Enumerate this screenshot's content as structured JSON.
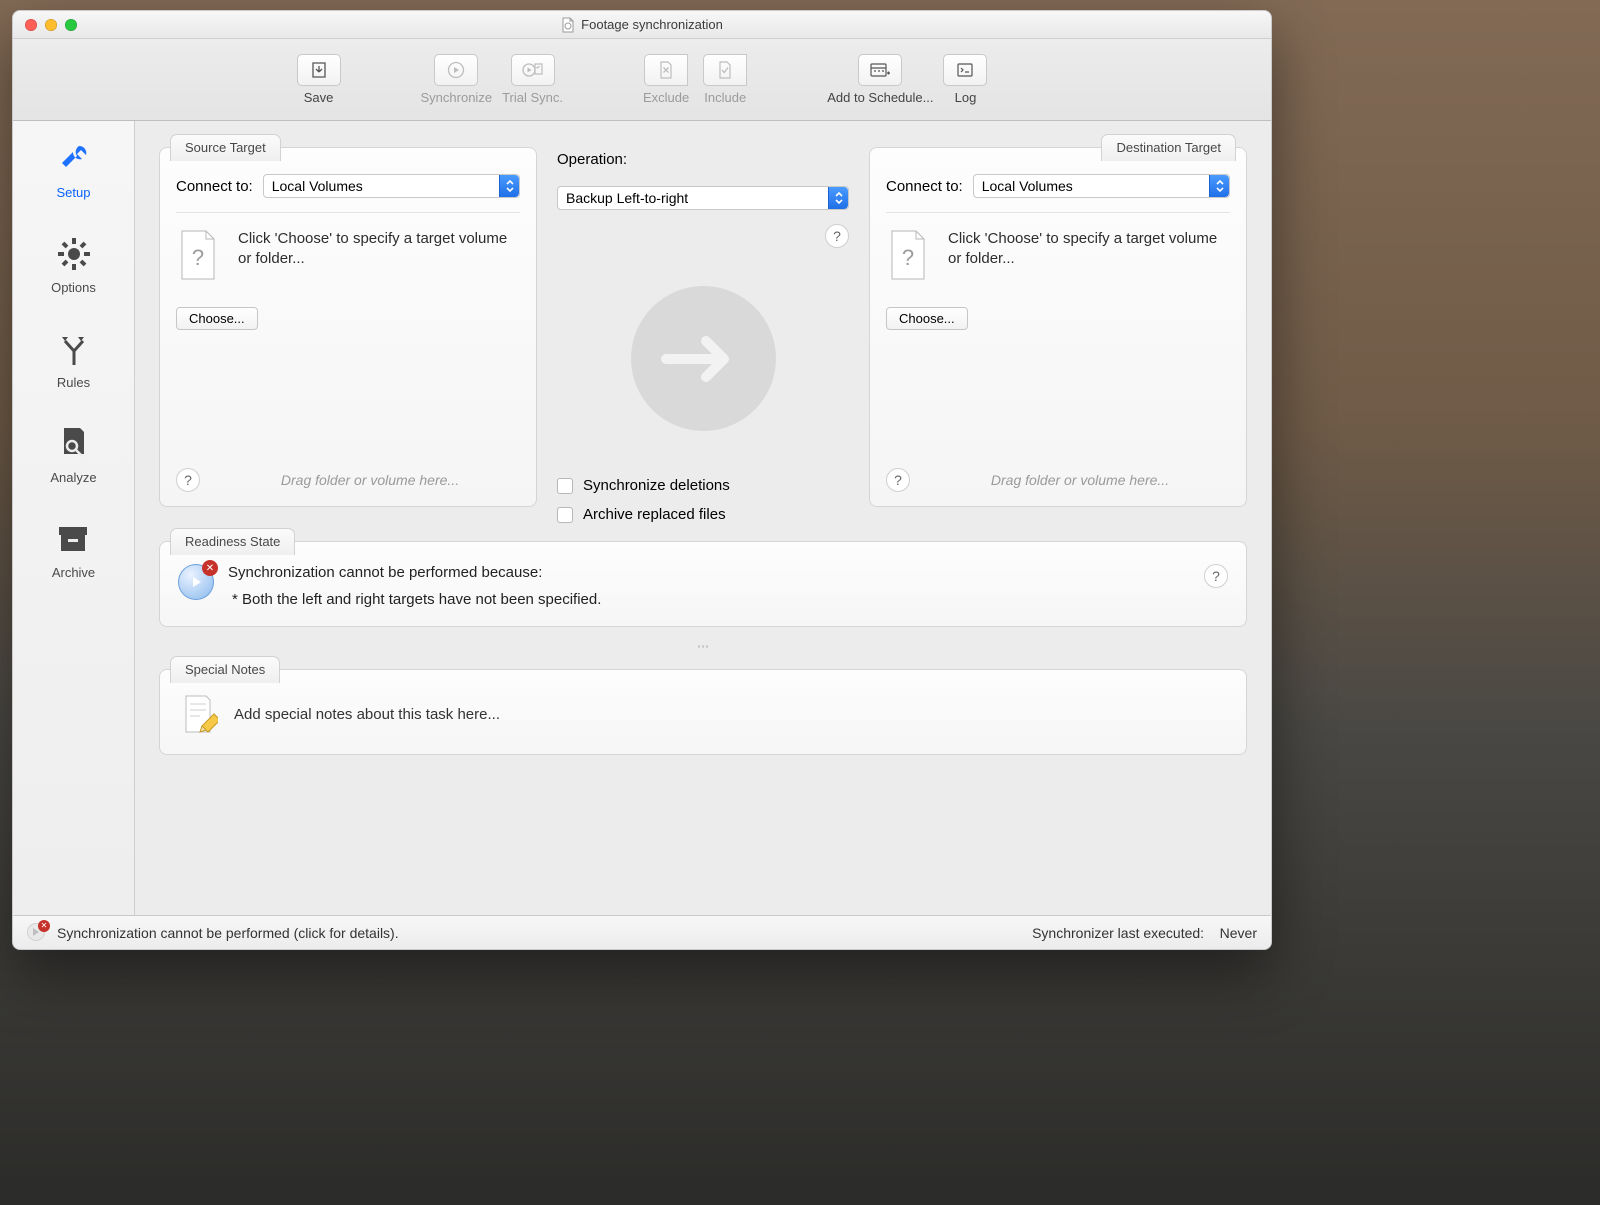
{
  "window": {
    "title": "Footage synchronization"
  },
  "toolbar": {
    "save": "Save",
    "synchronize": "Synchronize",
    "trial": "Trial Sync.",
    "exclude": "Exclude",
    "include": "Include",
    "schedule": "Add to Schedule...",
    "log": "Log"
  },
  "sidebar": {
    "setup": "Setup",
    "options": "Options",
    "rules": "Rules",
    "analyze": "Analyze",
    "archive": "Archive"
  },
  "source": {
    "title": "Source Target",
    "connect_label": "Connect to:",
    "connect_value": "Local Volumes",
    "prompt": "Click 'Choose' to specify a target volume or folder...",
    "choose": "Choose...",
    "hint": "Drag folder or volume here..."
  },
  "operation": {
    "label": "Operation:",
    "value": "Backup Left-to-right",
    "sync_deletions": "Synchronize deletions",
    "archive_replaced": "Archive replaced files"
  },
  "destination": {
    "title": "Destination Target",
    "connect_label": "Connect to:",
    "connect_value": "Local Volumes",
    "prompt": "Click 'Choose' to specify a target volume or folder...",
    "choose": "Choose...",
    "hint": "Drag folder or volume here..."
  },
  "readiness": {
    "title": "Readiness State",
    "heading": "Synchronization cannot be performed because:",
    "bullet": "* Both the left and right targets have not been specified."
  },
  "notes": {
    "title": "Special Notes",
    "placeholder": "Add special notes about this task here..."
  },
  "status": {
    "left": "Synchronization cannot be performed (click for details).",
    "right_label": "Synchronizer last executed:",
    "right_value": "Never"
  },
  "help_glyph": "?"
}
